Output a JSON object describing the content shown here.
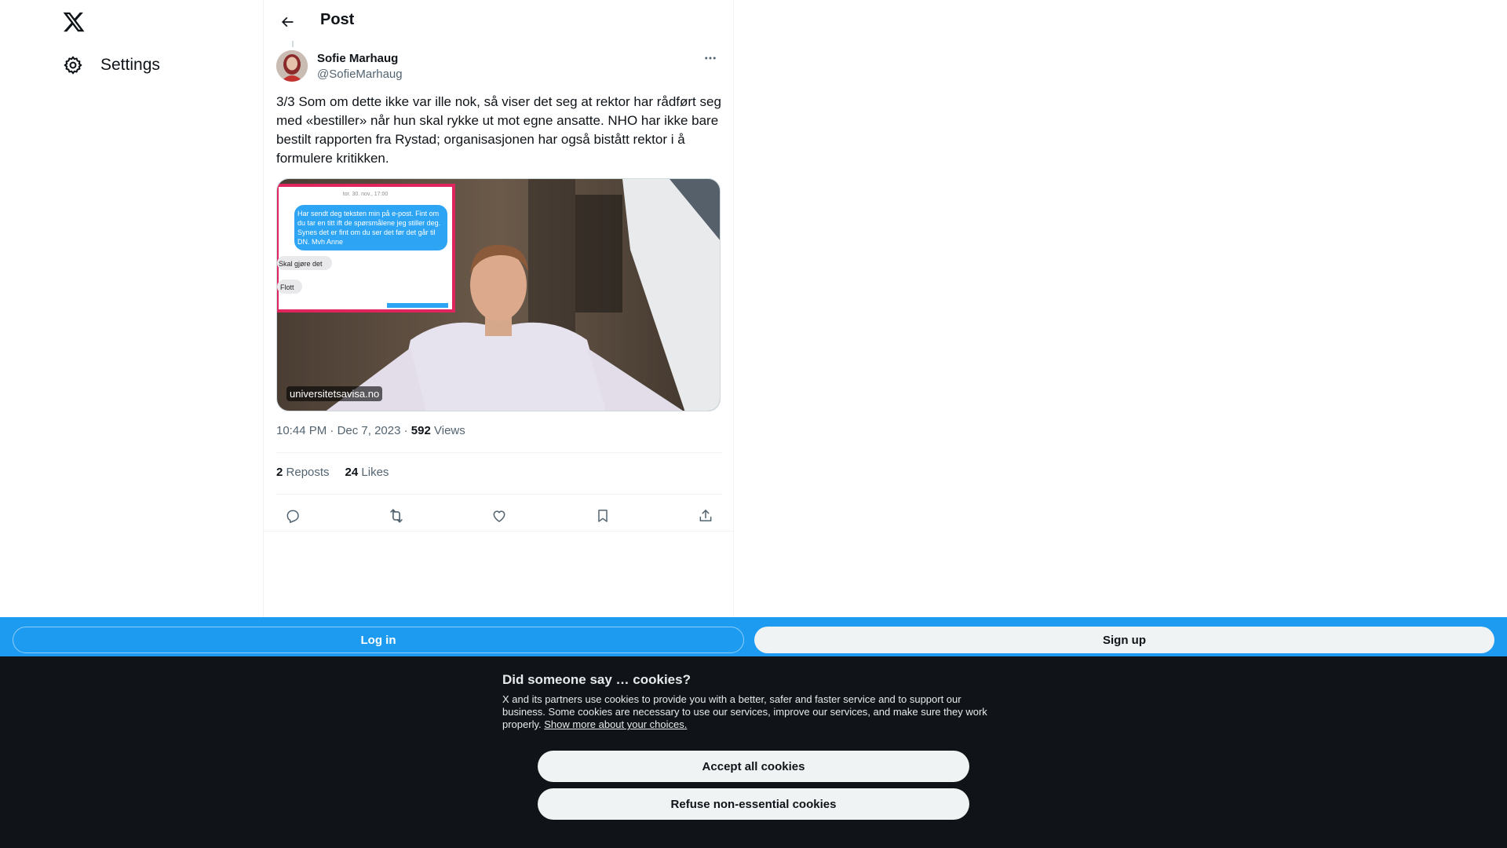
{
  "nav": {
    "logo_icon": "x-logo-icon",
    "settings_label": "Settings",
    "settings_icon": "gear-icon"
  },
  "header": {
    "title": "Post",
    "back_icon": "arrow-left-icon"
  },
  "tweet": {
    "author_name": "Sofie Marhaug",
    "author_handle": "@SofieMarhaug",
    "text": "3/3 Som om dette ikke var ille nok, så viser det seg at rektor har rådført seg med «bestiller» når hun skal rykke ut mot egne ansatte. NHO har ikke bare bestilt rapporten fra Rystad; organisasjonen har også bistått rektor i å formulere kritikken.",
    "media": {
      "source_label": "universitetsavisa.no",
      "sms_date": "tor. 30. nov., 17:00",
      "sms_bubble": "Har sendt deg teksten min på e-post. Fint om du tar en titt ift de spørsmålene jeg stiller deg. Synes det er fint om du ser det før det går til DN. Mvh Anne",
      "sms_reply_1": "Skal gjøre det",
      "sms_reply_2": "Flott"
    },
    "time": "10:44 PM",
    "date": "Dec 7, 2023",
    "views_count": "592",
    "views_label": "Views",
    "reposts_count": "2",
    "reposts_label": "Reposts",
    "likes_count": "24",
    "likes_label": "Likes"
  },
  "login_bar": {
    "login_label": "Log in",
    "signup_label": "Sign up"
  },
  "cookie": {
    "title": "Did someone say … cookies?",
    "body": "X and its partners use cookies to provide you with a better, safer and faster service and to support our business. Some cookies are necessary to use our services, improve our services, and make sure they work properly.",
    "link": "Show more about your choices.",
    "accept_label": "Accept all cookies",
    "refuse_label": "Refuse non-essential cookies"
  },
  "colors": {
    "accent": "#1d9bf0",
    "text_primary": "#0f1419",
    "text_secondary": "#536471",
    "cookie_bg": "#101418",
    "sms_frame": "#e0245e"
  }
}
